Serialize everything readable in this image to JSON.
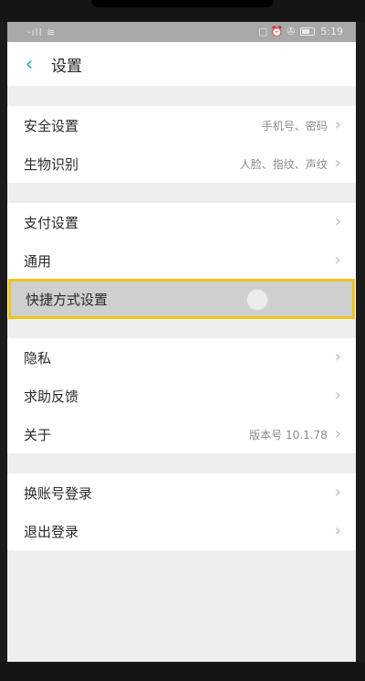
{
  "status_bar": {
    "left_icons": "·ıll ≋",
    "right_icons": "▢ ⏰ ✇",
    "time": "5:19"
  },
  "header": {
    "back_icon": "‹",
    "title": "设置"
  },
  "groups": [
    {
      "items": [
        {
          "label": "安全设置",
          "value": "手机号、密码"
        },
        {
          "label": "生物识别",
          "value": "人脸、指纹、声纹"
        }
      ]
    },
    {
      "items": [
        {
          "label": "支付设置",
          "value": ""
        },
        {
          "label": "通用",
          "value": ""
        },
        {
          "label": "快捷方式设置",
          "value": ""
        }
      ]
    },
    {
      "items": [
        {
          "label": "隐私",
          "value": ""
        },
        {
          "label": "求助反馈",
          "value": ""
        },
        {
          "label": "关于",
          "value": "版本号 10.1.78"
        }
      ]
    },
    {
      "items": [
        {
          "label": "换账号登录",
          "value": ""
        },
        {
          "label": "退出登录",
          "value": ""
        }
      ]
    }
  ],
  "icons": {
    "chevron": "›"
  },
  "colors": {
    "accent": "#2aa9b5",
    "highlight_border": "#f0c419"
  }
}
